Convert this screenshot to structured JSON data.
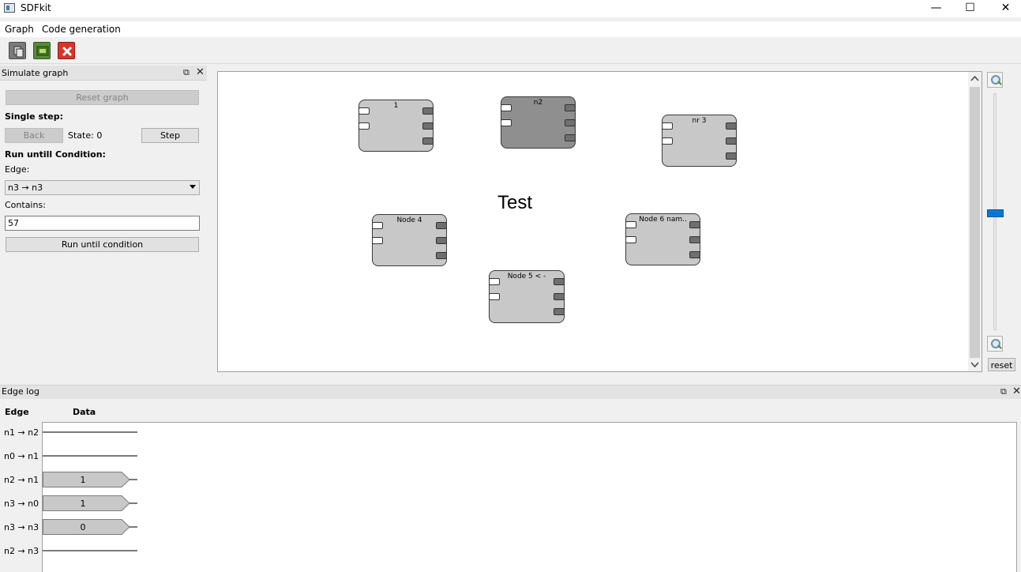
{
  "app": {
    "title": "SDFkit"
  },
  "window_controls": {
    "minimize": "—",
    "maximize": "☐",
    "close": "✕"
  },
  "menu": {
    "items": [
      "Graph",
      "Code generation"
    ]
  },
  "toolbar": {
    "buttons": [
      "copy-icon",
      "chip-icon",
      "delete-icon"
    ]
  },
  "simulate": {
    "title": "Simulate graph",
    "reset_label": "Reset graph",
    "single_step_label": "Single step:",
    "back_label": "Back",
    "state_text": "State: 0",
    "step_label": "Step",
    "run_until_label": "Run untill Condition:",
    "edge_label": "Edge:",
    "edge_value": "n3 → n3",
    "contains_label": "Contains:",
    "contains_value": "57",
    "run_button_label": "Run until condition"
  },
  "graph": {
    "title": "Test",
    "nodes": [
      {
        "label": "1"
      },
      {
        "label": "n2"
      },
      {
        "label": "nr 3"
      },
      {
        "label": "Node 4"
      },
      {
        "label": "Node 5 < -"
      },
      {
        "label": "Node 6 nam.."
      }
    ]
  },
  "zoom": {
    "reset_label": "reset"
  },
  "edge_log": {
    "title": "Edge log",
    "col_edge": "Edge",
    "col_data": "Data",
    "rows": [
      {
        "edge": "n1 → n2",
        "token": ""
      },
      {
        "edge": "n0 → n1",
        "token": ""
      },
      {
        "edge": "n2 → n1",
        "token": "1"
      },
      {
        "edge": "n3 → n0",
        "token": "1"
      },
      {
        "edge": "n3 → n3",
        "token": "0"
      },
      {
        "edge": "n2 → n3",
        "token": ""
      }
    ]
  },
  "colors": {
    "accent": "#0078d7",
    "node": "#c8c8c8",
    "node_selected": "#8f8f8f",
    "delete": "#d9342b"
  }
}
